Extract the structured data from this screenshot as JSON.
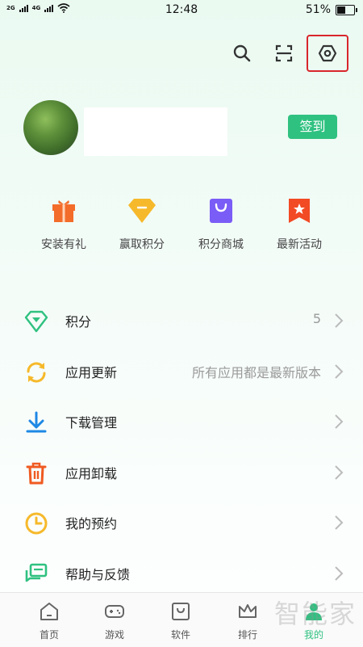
{
  "status_bar": {
    "time": "12:48",
    "battery": "51%",
    "battery_level": 0.51,
    "network_1": "2G",
    "network_2": "4G"
  },
  "header": {
    "icons": [
      "search-icon",
      "scan-icon",
      "settings-icon"
    ]
  },
  "profile": {
    "checkin_label": "签到"
  },
  "quick_actions": [
    {
      "label": "安装有礼",
      "icon": "gift-icon",
      "color": "#f36c2a"
    },
    {
      "label": "赢取积分",
      "icon": "diamond-icon",
      "color": "#f6b92b"
    },
    {
      "label": "积分商城",
      "icon": "shopping-bag-icon",
      "color": "#7a5cf6"
    },
    {
      "label": "最新活动",
      "icon": "bookmark-star-icon",
      "color": "#f24a24"
    }
  ],
  "menu": [
    {
      "label": "积分",
      "value": "5",
      "icon": "diamond-outline-icon",
      "color": "#2fc180"
    },
    {
      "label": "应用更新",
      "value": "所有应用都是最新版本",
      "icon": "refresh-icon",
      "color": "#f6b92b"
    },
    {
      "label": "下载管理",
      "value": "",
      "icon": "download-icon",
      "color": "#1e88e5"
    },
    {
      "label": "应用卸载",
      "value": "",
      "icon": "trash-icon",
      "color": "#f05a22"
    },
    {
      "label": "我的预约",
      "value": "",
      "icon": "clock-icon",
      "color": "#f6b92b"
    },
    {
      "label": "帮助与反馈",
      "value": "",
      "icon": "chat-icon",
      "color": "#2fc180"
    }
  ],
  "tabs": [
    {
      "label": "首页",
      "icon": "home-icon"
    },
    {
      "label": "游戏",
      "icon": "gamepad-icon"
    },
    {
      "label": "软件",
      "icon": "software-icon"
    },
    {
      "label": "排行",
      "icon": "crown-icon"
    },
    {
      "label": "我的",
      "icon": "person-icon",
      "active": true
    }
  ],
  "watermark": "智能家",
  "colors": {
    "accent": "#2fc180",
    "highlight_border": "#d9262c"
  }
}
